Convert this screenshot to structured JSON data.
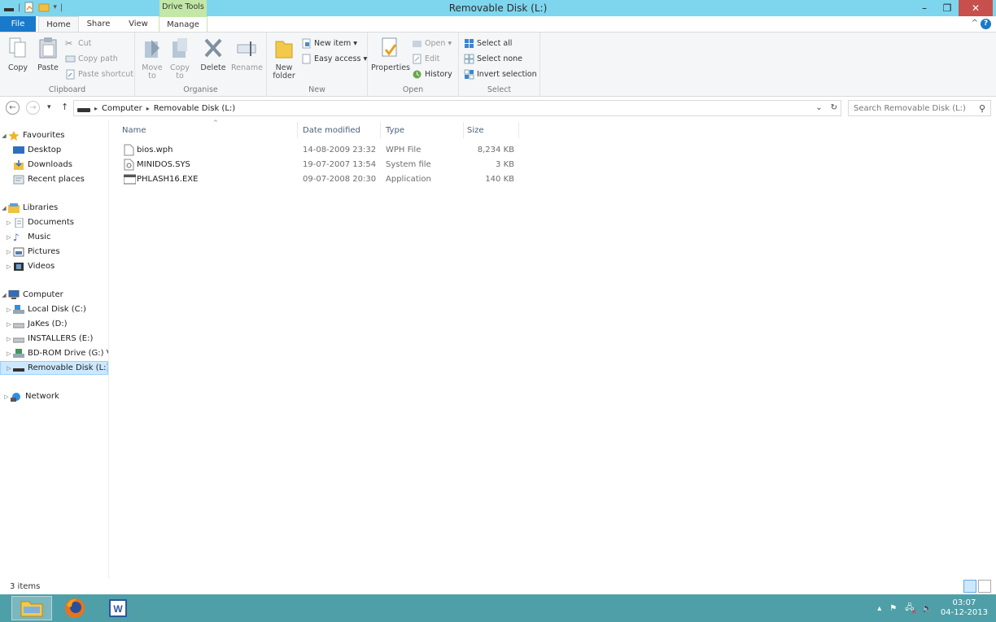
{
  "window": {
    "title": "Removable Disk (L:)",
    "drive_tools": "Drive Tools"
  },
  "tabs": {
    "file": "File",
    "home": "Home",
    "share": "Share",
    "view": "View",
    "manage": "Manage"
  },
  "ribbon": {
    "clipboard": {
      "label": "Clipboard",
      "copy": "Copy",
      "paste": "Paste",
      "cut": "Cut",
      "copy_path": "Copy path",
      "paste_shortcut": "Paste shortcut"
    },
    "organise": {
      "label": "Organise",
      "move_to": "Move to",
      "copy_to": "Copy to",
      "delete": "Delete",
      "rename": "Rename"
    },
    "new": {
      "label": "New",
      "new_folder": "New folder",
      "new_item": "New item",
      "easy_access": "Easy access"
    },
    "open": {
      "label": "Open",
      "properties": "Properties",
      "open": "Open",
      "edit": "Edit",
      "history": "History"
    },
    "select": {
      "label": "Select",
      "select_all": "Select all",
      "select_none": "Select none",
      "invert_selection": "Invert selection"
    }
  },
  "address": {
    "crumbs": [
      "Computer",
      "Removable Disk (L:)"
    ],
    "search_placeholder": "Search Removable Disk (L:)"
  },
  "nav": {
    "favourites": "Favourites",
    "favourites_items": [
      "Desktop",
      "Downloads",
      "Recent places"
    ],
    "libraries": "Libraries",
    "libraries_items": [
      "Documents",
      "Music",
      "Pictures",
      "Videos"
    ],
    "computer": "Computer",
    "computer_items": [
      "Local Disk (C:)",
      "JaKes (D:)",
      "INSTALLERS (E:)",
      "BD-ROM Drive (G:) V",
      "Removable Disk (L:)"
    ],
    "network": "Network"
  },
  "columns": {
    "name": "Name",
    "date": "Date modified",
    "type": "Type",
    "size": "Size"
  },
  "files": [
    {
      "name": "bios.wph",
      "date": "14-08-2009 23:32",
      "type": "WPH File",
      "size": "8,234 KB"
    },
    {
      "name": "MINIDOS.SYS",
      "date": "19-07-2007 13:54",
      "type": "System file",
      "size": "3 KB"
    },
    {
      "name": "PHLASH16.EXE",
      "date": "09-07-2008 20:30",
      "type": "Application",
      "size": "140 KB"
    }
  ],
  "status": {
    "count": "3 items"
  },
  "taskbar": {
    "time": "03:07",
    "date": "04-12-2013"
  }
}
